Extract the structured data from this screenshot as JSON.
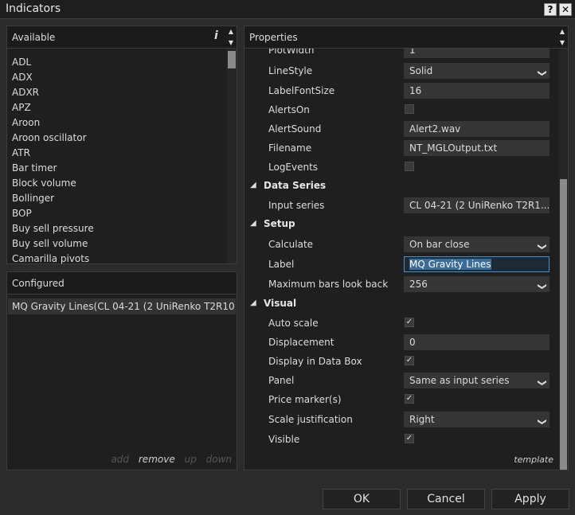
{
  "window": {
    "title": "Indicators",
    "help_glyph": "?",
    "close_glyph": "✕"
  },
  "available": {
    "header": "Available",
    "info_glyph": "i",
    "items": [
      "ADL",
      "ADX",
      "ADXR",
      "APZ",
      "Aroon",
      "Aroon oscillator",
      "ATR",
      "Bar timer",
      "Block volume",
      "Bollinger",
      "BOP",
      "Buy sell pressure",
      "Buy sell volume",
      "Camarilla pivots"
    ]
  },
  "configured": {
    "header": "Configured",
    "items": [
      "MQ Gravity Lines(CL 04-21 (2 UniRenko T2R10..."
    ],
    "actions": {
      "add": "add",
      "remove": "remove",
      "up": "up",
      "down": "down"
    }
  },
  "properties": {
    "header": "Properties",
    "partial_label": "PlotWidth",
    "partial_value": "1",
    "rows": {
      "linestyle": {
        "label": "LineStyle",
        "value": "Solid"
      },
      "labelfontsize": {
        "label": "LabelFontSize",
        "value": "16"
      },
      "alertson": {
        "label": "AlertsOn",
        "checked": false
      },
      "alertsound": {
        "label": "AlertSound",
        "value": "Alert2.wav"
      },
      "filename": {
        "label": "Filename",
        "value": "NT_MGLOutput.txt"
      },
      "logevents": {
        "label": "LogEvents",
        "checked": false
      },
      "inputseries": {
        "label": "Input series",
        "value": "CL 04-21 (2 UniRenko T2R1..."
      },
      "calculate": {
        "label": "Calculate",
        "value": "On bar close"
      },
      "label": {
        "label": "Label",
        "value": "MQ Gravity Lines"
      },
      "maxbars": {
        "label": "Maximum bars look back",
        "value": "256"
      },
      "autoscale": {
        "label": "Auto scale",
        "checked": true
      },
      "displacement": {
        "label": "Displacement",
        "value": "0"
      },
      "databox": {
        "label": "Display in Data Box",
        "checked": true
      },
      "panel": {
        "label": "Panel",
        "value": "Same as input series"
      },
      "pricemarker": {
        "label": "Price marker(s)",
        "checked": true
      },
      "scalejust": {
        "label": "Scale justification",
        "value": "Right"
      },
      "visible": {
        "label": "Visible",
        "checked": true
      }
    },
    "categories": {
      "data_series": "Data Series",
      "setup": "Setup",
      "visual": "Visual"
    },
    "template": "template"
  },
  "buttons": {
    "ok": "OK",
    "cancel": "Cancel",
    "apply": "Apply"
  }
}
